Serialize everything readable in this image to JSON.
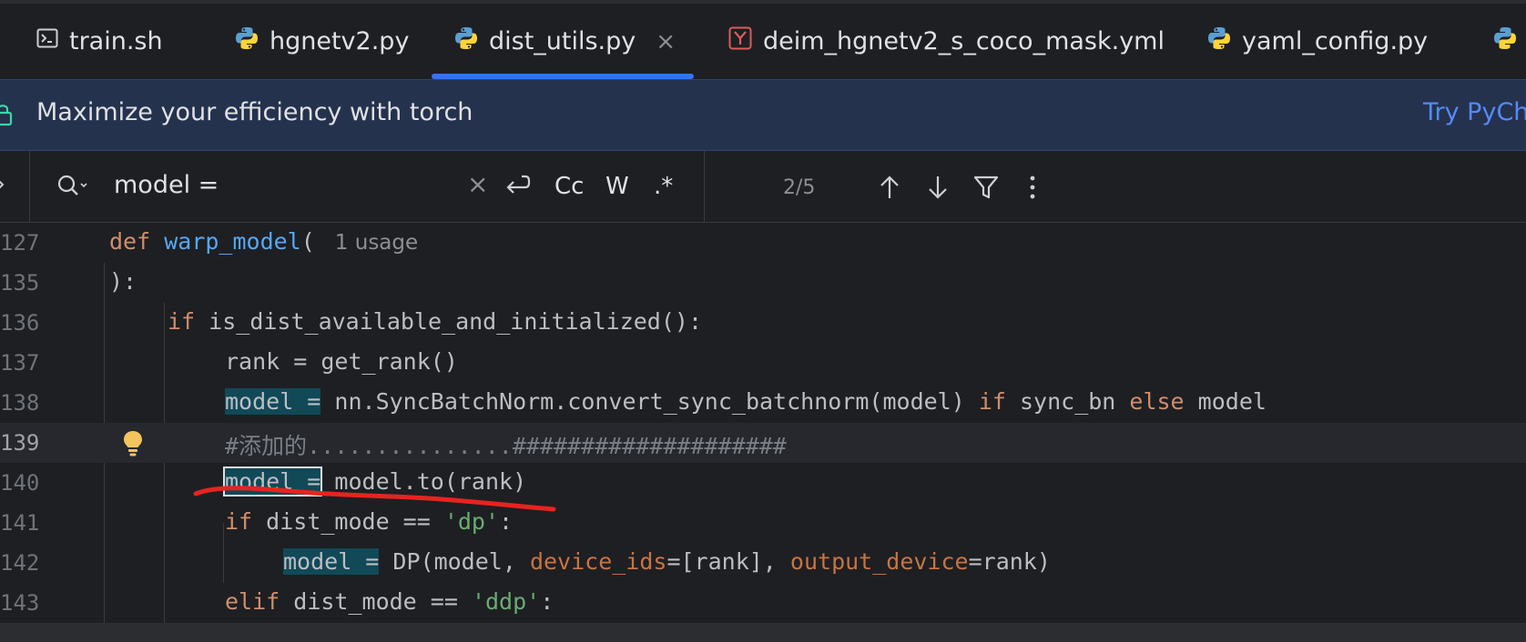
{
  "tabs": [
    {
      "label": "train.sh",
      "icon": "terminal-icon"
    },
    {
      "label": "hgnetv2.py",
      "icon": "python-icon"
    },
    {
      "label": "dist_utils.py",
      "icon": "python-icon",
      "close": "×"
    },
    {
      "label": "deim_hgnetv2_s_coco_mask.yml",
      "icon": "yaml-icon"
    },
    {
      "label": "yaml_config.py",
      "icon": "python-icon"
    }
  ],
  "banner": {
    "text": "Maximize your efficiency with torch",
    "link": "Try PyCha"
  },
  "find": {
    "query": "model =",
    "clear": "×",
    "case_label": "Cc",
    "word_label": "W",
    "regex_label": ".*",
    "counter": "2/5"
  },
  "code": {
    "ln127": "127",
    "ln135": "135",
    "ln136": "136",
    "ln137": "137",
    "ln138": "138",
    "ln139": "139",
    "ln140": "140",
    "ln141": "141",
    "ln142": "142",
    "ln143": "143",
    "def_kw": "def",
    "fn_name": "warp_model",
    "open_paren": "(",
    "usage_hint": "1 usage",
    "close_paren": "):",
    "if_kw": "if",
    "l136_rest": " is_dist_available_and_initialized():",
    "l137": "rank = get_rank()",
    "match_text": "model =",
    "l138_mid": " nn.SyncBatchNorm.convert_sync_batchnorm(model) ",
    "l138_if": "if",
    "l138_mid2": " sync_bn ",
    "l138_else": "else",
    "l138_end": " model",
    "l139_comment": "#添加的...............####################",
    "l140_rest": " model.to(rank)",
    "l141_if": "if",
    "l141_mid": " dist_mode == ",
    "l141_str": "'dp'",
    "l141_end": ":",
    "l142_a": " DP(model, ",
    "l142_p1": "device_ids",
    "l142_b": "=[rank], ",
    "l142_p2": "output_device",
    "l142_c": "=rank)",
    "l143_elif": "elif",
    "l143_mid": " dist_mode == ",
    "l143_str": "'ddp'",
    "l143_end": ":"
  }
}
